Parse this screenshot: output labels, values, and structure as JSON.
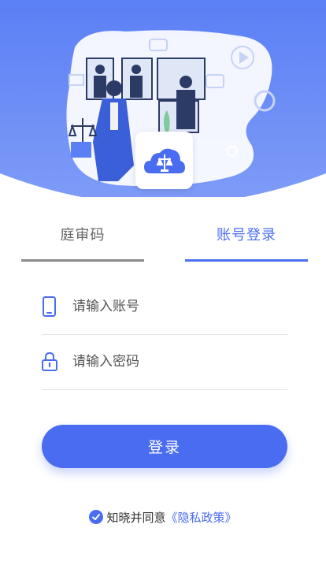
{
  "tabs": {
    "code_label": "庭审码",
    "account_label": "账号登录",
    "active": "account"
  },
  "form": {
    "account_placeholder": "请输入账号",
    "password_placeholder": "请输入密码",
    "account_value": "",
    "password_value": ""
  },
  "login_button": {
    "label": "登录"
  },
  "agreement": {
    "text": "知晓并同意",
    "policy_link": "《隐私政策》",
    "checked": true
  },
  "icons": {
    "phone": "phone-icon",
    "lock": "lock-icon",
    "check": "check-icon",
    "logo": "app-logo-icon"
  },
  "colors": {
    "primary": "#4a6cf0",
    "header_gradient_start": "#5b7ff5",
    "header_gradient_end": "#7f9cf7",
    "inactive_tab": "#666666"
  }
}
